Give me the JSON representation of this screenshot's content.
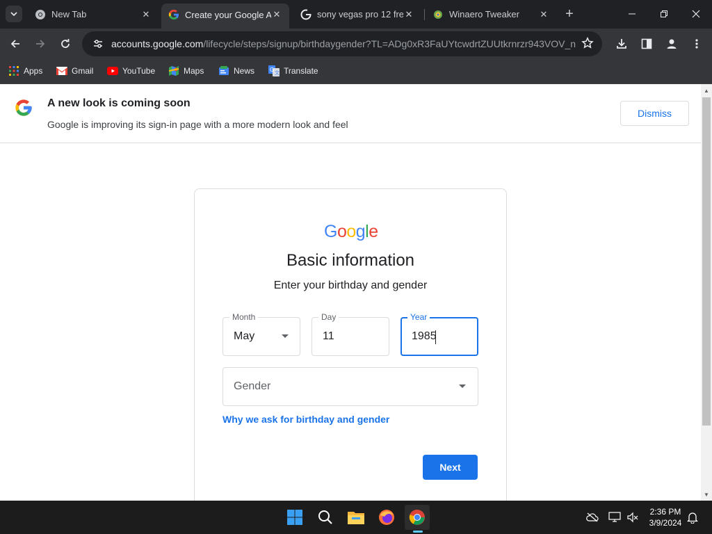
{
  "tabs": [
    {
      "title": "New Tab",
      "favicon": "chrome-icon",
      "active": false
    },
    {
      "title": "Create your Google Ac",
      "favicon": "google-icon",
      "active": true
    },
    {
      "title": "sony vegas pro 12 free",
      "favicon": "google-icon",
      "active": false
    },
    {
      "title": "Winaero Tweaker",
      "favicon": "winaero-icon",
      "active": false
    }
  ],
  "omnibox": {
    "host": "accounts.google.com",
    "path": "/lifecycle/steps/signup/birthdaygender?TL=ADg0xR3FaUYtcwdrtZUUtkrnrzr943VOV_n..."
  },
  "bookmarks": [
    {
      "label": "Apps",
      "icon": "apps-grid-icon"
    },
    {
      "label": "Gmail",
      "icon": "gmail-icon"
    },
    {
      "label": "YouTube",
      "icon": "youtube-icon"
    },
    {
      "label": "Maps",
      "icon": "maps-icon"
    },
    {
      "label": "News",
      "icon": "news-icon"
    },
    {
      "label": "Translate",
      "icon": "translate-icon"
    }
  ],
  "banner": {
    "title": "A new look is coming soon",
    "text": "Google is improving its sign-in page with a more modern look and feel",
    "dismiss_label": "Dismiss"
  },
  "form": {
    "logo_text": "Google",
    "title": "Basic information",
    "subtitle": "Enter your birthday and gender",
    "month": {
      "label": "Month",
      "value": "May"
    },
    "day": {
      "label": "Day",
      "value": "11"
    },
    "year": {
      "label": "Year",
      "value": "1985"
    },
    "gender": {
      "placeholder": "Gender"
    },
    "why_link": "Why we ask for birthday and gender",
    "next_label": "Next"
  },
  "taskbar": {
    "time": "2:36 PM",
    "date": "3/9/2024"
  },
  "colors": {
    "accent": "#1a73e8",
    "google_blue": "#4285f4",
    "google_red": "#ea4335",
    "google_yellow": "#fbbc05",
    "google_green": "#34a853"
  }
}
